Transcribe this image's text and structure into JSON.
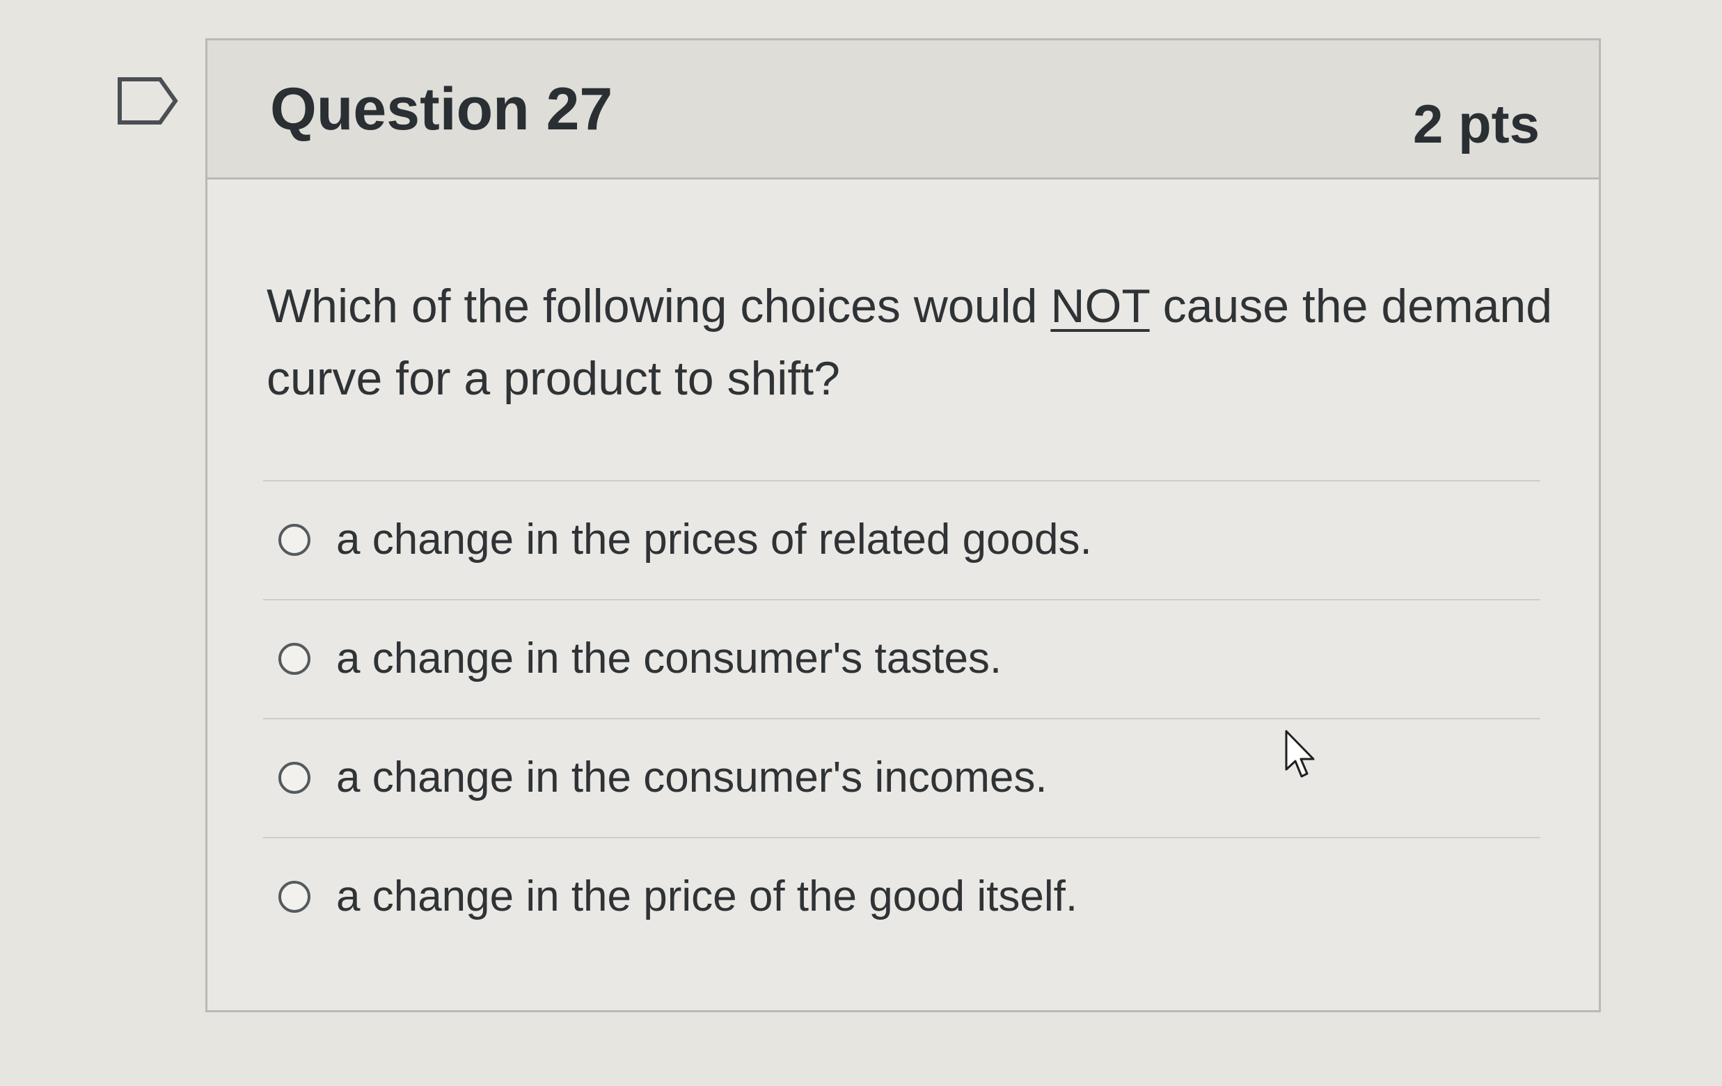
{
  "question": {
    "title": "Question 27",
    "points": "2 pts",
    "prompt_before": "Which of the following choices would ",
    "prompt_emphasis": "NOT",
    "prompt_after": " cause the demand curve for a product to  shift?"
  },
  "answers": [
    {
      "label": "a change in the prices of related goods.",
      "selected": false
    },
    {
      "label": "a change in the consumer's tastes.",
      "selected": false
    },
    {
      "label": "a change in the consumer's incomes.",
      "selected": false
    },
    {
      "label": "a change in the price of the good itself.",
      "selected": false
    }
  ],
  "icons": {
    "flag": "flag-outline-icon",
    "cursor": "mouse-pointer-icon"
  },
  "colors": {
    "text": "#2d3b45",
    "background": "#e7e5e0",
    "header_background": "#deddd8",
    "border": "#b9b9b5"
  }
}
